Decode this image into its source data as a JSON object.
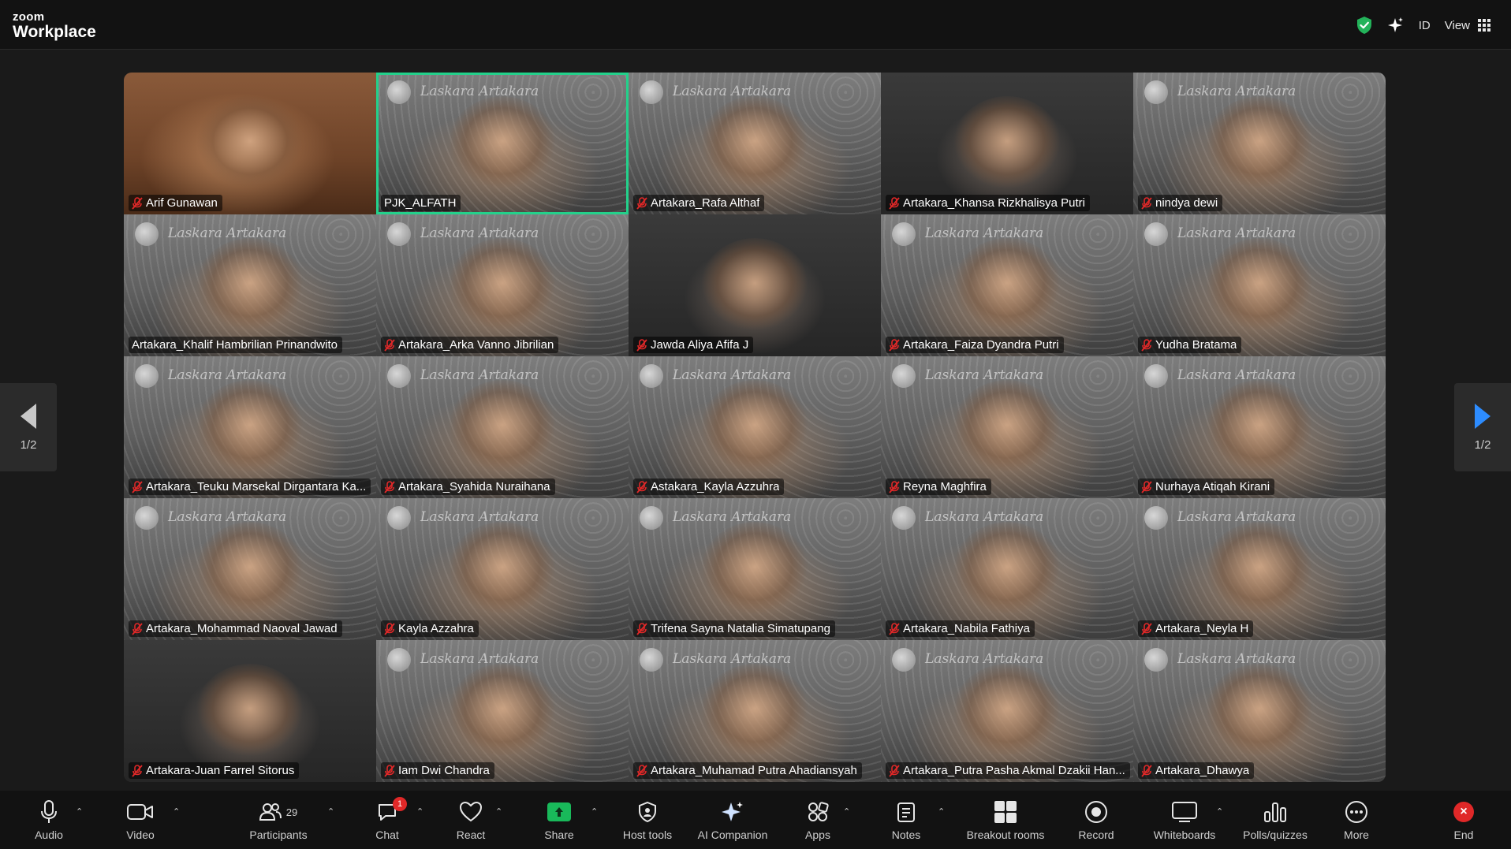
{
  "topbar": {
    "brand_small": "zoom",
    "brand_big": "Workplace",
    "id_label": "ID",
    "view_label": "View"
  },
  "pager": {
    "left_label": "1/2",
    "right_label": "1/2"
  },
  "watermark_text": "Laskara Artakara",
  "participants": [
    {
      "name": "Arif Gunawan",
      "muted": true,
      "style": "warm"
    },
    {
      "name": "PJK_ALFATH",
      "muted": false,
      "style": "bg",
      "active": true
    },
    {
      "name": "Artakara_Rafa Althaf",
      "muted": true,
      "style": "bg"
    },
    {
      "name": "Artakara_Khansa Rizkhalisya Putri",
      "muted": true,
      "style": "dark"
    },
    {
      "name": "nindya dewi",
      "muted": true,
      "style": "bg"
    },
    {
      "name": "Artakara_Khalif Hambrilian Prinandwito",
      "muted": false,
      "style": "bg"
    },
    {
      "name": "Artakara_Arka Vanno Jibrilian",
      "muted": true,
      "style": "bg"
    },
    {
      "name": "Jawda Aliya Afifa J",
      "muted": true,
      "style": "dark"
    },
    {
      "name": "Artakara_Faiza Dyandra Putri",
      "muted": true,
      "style": "bg"
    },
    {
      "name": "Yudha Bratama",
      "muted": true,
      "style": "bg"
    },
    {
      "name": "Artakara_Teuku Marsekal Dirgantara Ka...",
      "muted": true,
      "style": "bg"
    },
    {
      "name": "Artakara_Syahida Nuraihana",
      "muted": true,
      "style": "bg"
    },
    {
      "name": "Astakara_Kayla Azzuhra",
      "muted": true,
      "style": "bg"
    },
    {
      "name": "Reyna Maghfira",
      "muted": true,
      "style": "bg"
    },
    {
      "name": "Nurhaya Atiqah Kirani",
      "muted": true,
      "style": "bg"
    },
    {
      "name": "Artakara_Mohammad Naoval Jawad",
      "muted": true,
      "style": "bg"
    },
    {
      "name": "Kayla Azzahra",
      "muted": true,
      "style": "bg"
    },
    {
      "name": "Trifena Sayna Natalia Simatupang",
      "muted": true,
      "style": "bg"
    },
    {
      "name": "Artakara_Nabila Fathiya",
      "muted": true,
      "style": "bg"
    },
    {
      "name": "Artakara_Neyla H",
      "muted": true,
      "style": "bg"
    },
    {
      "name": "Artakara-Juan Farrel Sitorus",
      "muted": true,
      "style": "dark"
    },
    {
      "name": "Iam Dwi Chandra",
      "muted": true,
      "style": "bg"
    },
    {
      "name": "Artakara_Muhamad Putra Ahadiansyah",
      "muted": true,
      "style": "bg"
    },
    {
      "name": "Artakara_Putra Pasha Akmal Dzakii Han...",
      "muted": true,
      "style": "bg"
    },
    {
      "name": "Artakara_Dhawya",
      "muted": true,
      "style": "bg"
    }
  ],
  "toolbar": {
    "audio": "Audio",
    "video": "Video",
    "participants": "Participants",
    "participants_count": "29",
    "chat": "Chat",
    "chat_badge": "1",
    "react": "React",
    "share": "Share",
    "host_tools": "Host tools",
    "ai_companion": "AI Companion",
    "apps": "Apps",
    "notes": "Notes",
    "breakout_rooms": "Breakout rooms",
    "record": "Record",
    "whiteboards": "Whiteboards",
    "polls": "Polls/quizzes",
    "more": "More",
    "end": "End"
  },
  "colors": {
    "active_speaker": "#23d18b",
    "muted_mic": "#e02828",
    "share_green": "#19b95a",
    "pager_arrow": "#2d8cff",
    "end_red": "#e02828"
  }
}
